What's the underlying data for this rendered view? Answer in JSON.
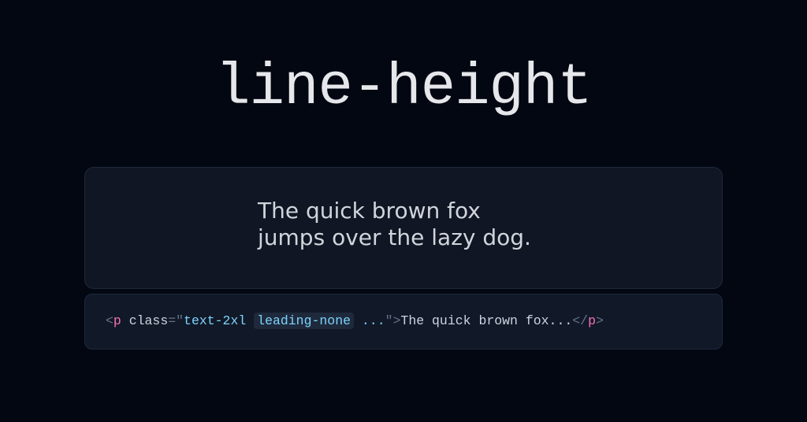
{
  "title": "line-height",
  "preview": {
    "line1": "The quick brown fox",
    "line2": "jumps over the lazy dog."
  },
  "code": {
    "open_bracket": "<",
    "tag_name": "p",
    "space": " ",
    "attr_name": "class",
    "eq": "=",
    "quote_open": "\"",
    "class1": "text-2xl",
    "class_sep": " ",
    "class2": "leading-none",
    "class_rest": " ...",
    "quote_close": "\"",
    "close_bracket": ">",
    "inner_text": "The quick brown fox...",
    "end_open": "</",
    "end_tag": "p",
    "end_close": ">"
  }
}
